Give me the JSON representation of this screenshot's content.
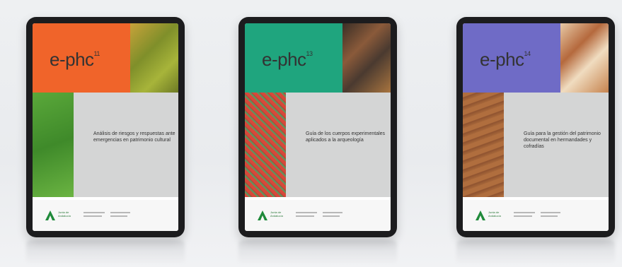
{
  "tablets": [
    {
      "logo": "e-phc",
      "issue": "11",
      "title": "Análisis de riesgos y respuestas ante emergencias en patrimonio cultural",
      "accent": "#f0642a",
      "top_photo": "#8f9a2a",
      "mid_photo": "#4f9a32"
    },
    {
      "logo": "e-phc",
      "issue": "13",
      "title": "Guía de los cuerpos experimentales aplicados a la arqueología",
      "accent": "#1fa57e",
      "top_photo": "#5a4a3a",
      "mid_photo": "#c6433a"
    },
    {
      "logo": "e-phc",
      "issue": "14",
      "title": "Guía para la gestión del patrimonio documental en hermandades y cofradías",
      "accent": "#6f6bc6",
      "top_photo": "#b5693d",
      "mid_photo": "#a5643a"
    }
  ],
  "footer": {
    "org": "Junta de Andalucía"
  }
}
